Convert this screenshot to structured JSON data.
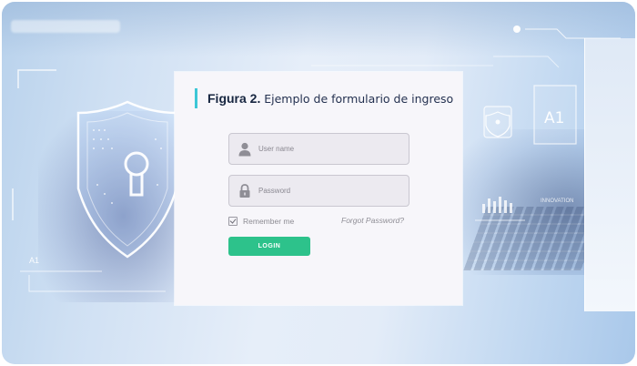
{
  "caption": {
    "figure": "Figura 2.",
    "title": "Ejemplo de formulario de ingreso"
  },
  "form": {
    "username": {
      "placeholder": "User name",
      "value": "",
      "icon": "user-icon"
    },
    "password": {
      "placeholder": "Password",
      "value": "",
      "icon": "lock-icon"
    },
    "remember_label": "Remember me",
    "remember_checked": true,
    "forgot_label": "Forgot Password?",
    "login_label": "LOGIN"
  },
  "background": {
    "hud_labels": {
      "a1_left": "A1",
      "a1_right": "A1",
      "innovation": "INNOVATION"
    }
  },
  "colors": {
    "accent_bar": "#3cc7d6",
    "login_button": "#2dc28b",
    "card_background": "#f7f6fa"
  }
}
